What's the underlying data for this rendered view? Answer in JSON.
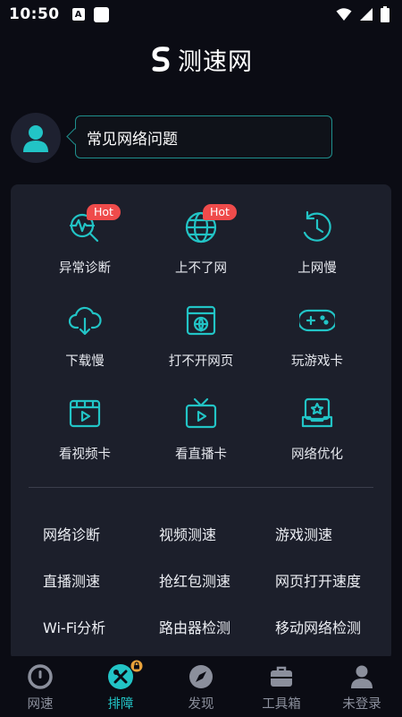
{
  "status_bar": {
    "time": "10:50",
    "a_icon_letter": "A"
  },
  "app": {
    "logo_text": "测速网"
  },
  "user": {
    "prompt": "常见网络问题"
  },
  "grid": [
    {
      "label": "异常诊断",
      "icon": "abnormal-diagnosis-icon",
      "badge": "Hot"
    },
    {
      "label": "上不了网",
      "icon": "globe-icon",
      "badge": "Hot"
    },
    {
      "label": "上网慢",
      "icon": "clock-icon"
    },
    {
      "label": "下载慢",
      "icon": "cloud-download-icon"
    },
    {
      "label": "打不开网页",
      "icon": "webpage-icon"
    },
    {
      "label": "玩游戏卡",
      "icon": "gamepad-icon"
    },
    {
      "label": "看视频卡",
      "icon": "video-icon"
    },
    {
      "label": "看直播卡",
      "icon": "tv-icon"
    },
    {
      "label": "网络优化",
      "icon": "optimize-icon"
    }
  ],
  "tools": [
    [
      "网络诊断",
      "视频测速",
      "游戏测速"
    ],
    [
      "直播测速",
      "抢红包测速",
      "网页打开速度"
    ],
    [
      "Wi-Fi分析",
      "路由器检测",
      "移动网络检测"
    ]
  ],
  "nav": [
    {
      "label": "网速",
      "icon": "speedometer-icon",
      "active": false
    },
    {
      "label": "排障",
      "icon": "tools-icon",
      "active": true
    },
    {
      "label": "发现",
      "icon": "compass-icon",
      "active": false
    },
    {
      "label": "工具箱",
      "icon": "toolbox-icon",
      "active": false
    },
    {
      "label": "未登录",
      "icon": "user-icon",
      "active": false
    }
  ],
  "colors": {
    "accent": "#22c4c6",
    "hot": "#ef4b4b",
    "background": "#0b0c14",
    "card": "#1c1f2b"
  }
}
